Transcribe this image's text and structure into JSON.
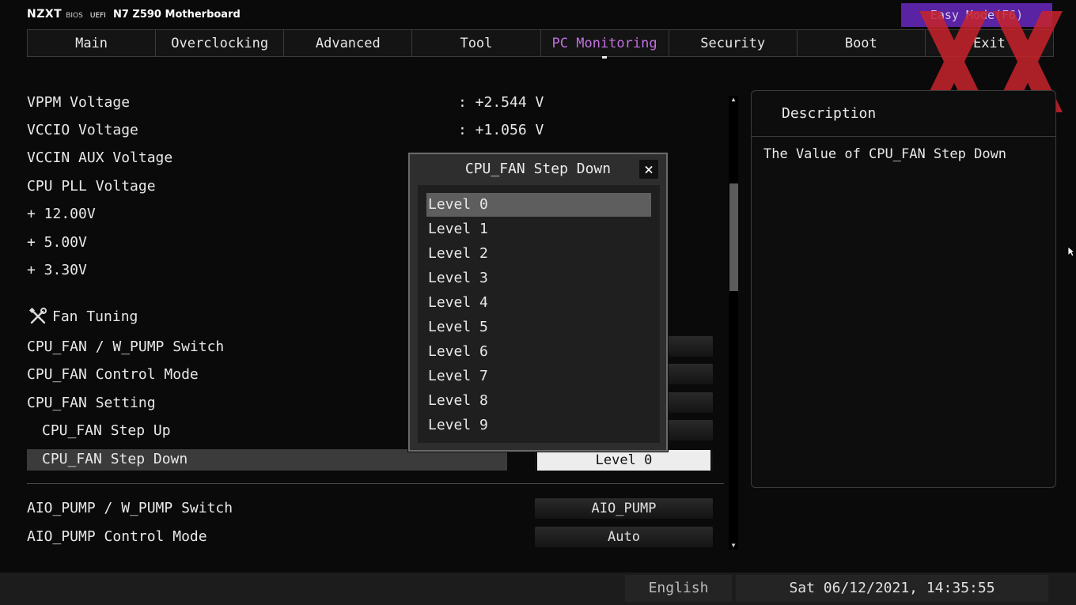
{
  "header": {
    "logo": "NZXT",
    "bios": "BIOS",
    "uefi": "UEFI",
    "model": "N7 Z590 Motherboard",
    "easy_mode": "Easy Mode(F6)"
  },
  "tabs": [
    {
      "label": "Main"
    },
    {
      "label": "Overclocking"
    },
    {
      "label": "Advanced"
    },
    {
      "label": "Tool"
    },
    {
      "label": "PC Monitoring",
      "active": true
    },
    {
      "label": "Security"
    },
    {
      "label": "Boot"
    },
    {
      "label": "Exit"
    }
  ],
  "monitor": [
    {
      "label": "VPPM Voltage",
      "value": ": +2.544 V"
    },
    {
      "label": "VCCIO Voltage",
      "value": ": +1.056 V"
    },
    {
      "label": "VCCIN AUX Voltage",
      "value": ""
    },
    {
      "label": "CPU PLL Voltage",
      "value": ""
    },
    {
      "label": "+ 12.00V",
      "value": ""
    },
    {
      "label": "+ 5.00V",
      "value": ""
    },
    {
      "label": "+ 3.30V",
      "value": ""
    }
  ],
  "fan": {
    "section_title": "Fan Tuning",
    "items": [
      {
        "label": "CPU_FAN / W_PUMP Switch",
        "value": ""
      },
      {
        "label": "CPU_FAN Control Mode",
        "value": ""
      },
      {
        "label": "CPU_FAN Setting",
        "value": ""
      },
      {
        "label": "CPU_FAN Step Up",
        "value": ""
      },
      {
        "label": "CPU_FAN Step Down",
        "value": "Level 0"
      },
      {
        "label": "AIO_PUMP / W_PUMP Switch",
        "value": "AIO_PUMP"
      },
      {
        "label": "AIO_PUMP Control Mode",
        "value": "Auto"
      }
    ]
  },
  "description": {
    "title": "Description",
    "text": "The Value of CPU_FAN Step Down"
  },
  "popup": {
    "title": "CPU_FAN Step Down",
    "close": "×",
    "options": [
      "Level 0",
      "Level 1",
      "Level 2",
      "Level 3",
      "Level 4",
      "Level 5",
      "Level 6",
      "Level 7",
      "Level 8",
      "Level 9"
    ],
    "selected": "Level 0"
  },
  "footer": {
    "language": "English",
    "datetime": "Sat 06/12/2021, 14:35:55"
  },
  "colors": {
    "accent": "#c070e0",
    "easy_mode_bg": "#5a23a3",
    "watermark": "#c8232c"
  }
}
